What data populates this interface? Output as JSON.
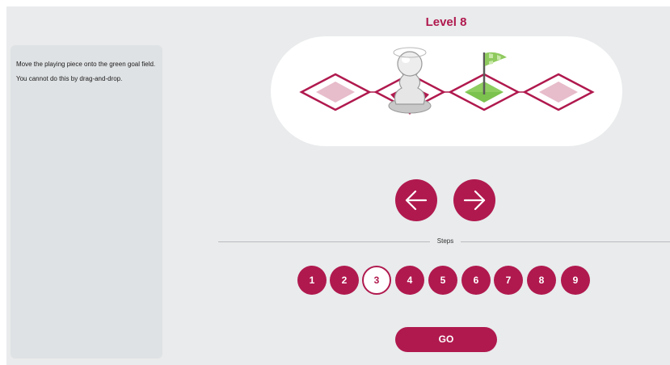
{
  "level": {
    "title": "Level 8"
  },
  "instructions": {
    "line1": "Move the playing piece onto the green goal field.",
    "line2": "You cannot do this by drag-and-drop."
  },
  "board": {
    "fields": [
      {
        "index": 0,
        "state": "empty"
      },
      {
        "index": 1,
        "state": "player"
      },
      {
        "index": 2,
        "state": "goal"
      },
      {
        "index": 3,
        "state": "empty"
      }
    ]
  },
  "controls": {
    "left_icon": "arrow-left-icon",
    "right_icon": "arrow-right-icon"
  },
  "steps": {
    "label": "Steps",
    "options": [
      "1",
      "2",
      "3",
      "4",
      "5",
      "6",
      "7",
      "8",
      "9"
    ],
    "selected": "3"
  },
  "go": {
    "label": "GO"
  },
  "colors": {
    "accent": "#b0194e",
    "field_fill": "#e7bccb",
    "goal_green": "#7cc24e",
    "background": "#e9ebec"
  }
}
